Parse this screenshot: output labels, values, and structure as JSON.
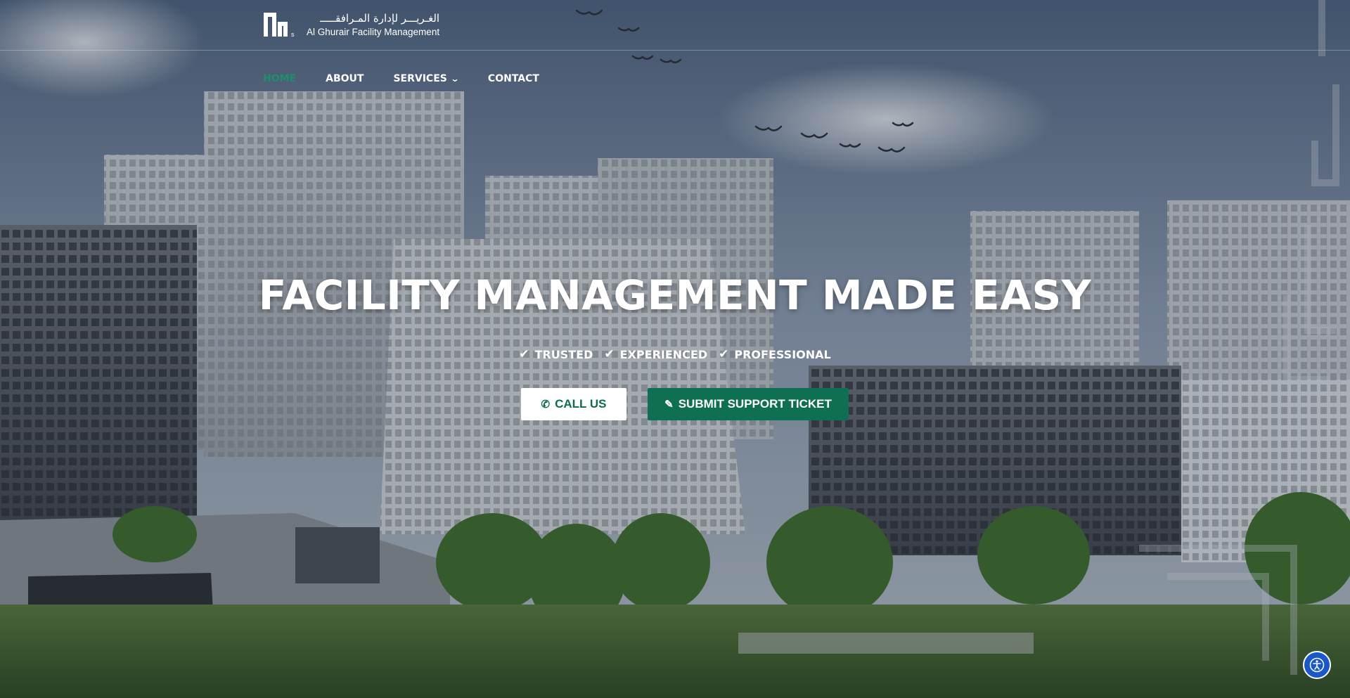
{
  "header": {
    "logo_arabic": "الغـريـــر لإدارة المـرافقـــــ",
    "logo_english": "Al Ghurair Facility Management",
    "logo_icon": "facility-mark-logo"
  },
  "nav": {
    "items": [
      {
        "label": "HOME",
        "active": true
      },
      {
        "label": "ABOUT",
        "active": false
      },
      {
        "label": "SERVICES",
        "active": false,
        "has_dropdown": true
      },
      {
        "label": "CONTACT",
        "active": false
      }
    ],
    "active_color": "#1e8f6c"
  },
  "hero": {
    "title": "FACILITY MANAGEMENT MADE EASY",
    "features": [
      {
        "label": "TRUSTED",
        "icon": "check-icon"
      },
      {
        "label": "EXPERIENCED",
        "icon": "check-icon"
      },
      {
        "label": "PROFESSIONAL",
        "icon": "check-icon"
      }
    ],
    "cta_call": {
      "label": "CALL US",
      "icon": "phone-icon"
    },
    "cta_ticket": {
      "label": "SUBMIT SUPPORT TICKET",
      "icon": "edit-icon"
    },
    "brand_green": "#0f6f52"
  },
  "accessibility": {
    "icon": "accessibility-icon",
    "color": "#1a57c8"
  }
}
